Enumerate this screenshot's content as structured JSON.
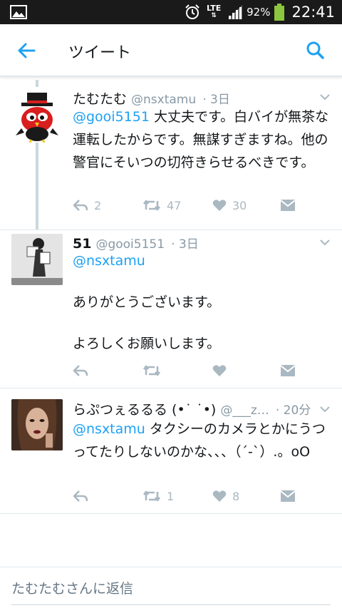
{
  "status_bar": {
    "network": "LTE",
    "battery": "92%",
    "time": "22:41",
    "battery_color": "#8cc63f"
  },
  "header": {
    "title": "ツイート",
    "accent_color": "#1da1f2"
  },
  "tweets": [
    {
      "name": "たむたむ",
      "handle": "@nsxtamu",
      "time": "· 3日",
      "mention": "@gooi5151",
      "text": " 大丈夫です。白バイが無茶な運転したからです。無謀すぎますね。他の警官にそいつの切符きらせるべきです。",
      "replies": "2",
      "retweets": "47",
      "likes": "30"
    },
    {
      "name": "51",
      "handle": "@gooi5151",
      "time": "· 3日",
      "mention": "@nsxtamu",
      "text": "\n\nありがとうございます。\n\nよろしくお願いします。",
      "replies": "",
      "retweets": "",
      "likes": ""
    },
    {
      "name": "らぷつぇるるる (•˙ ˙•)",
      "handle": "@___z…",
      "time": "· 20分",
      "mention": "@nsxtamu",
      "text": " タクシーのカメラとかにうつってたりしないのかな、、、（´-`）.。oO",
      "replies": "",
      "retweets": "1",
      "likes": "8"
    }
  ],
  "reply": {
    "placeholder": "たむたむさんに返信"
  }
}
